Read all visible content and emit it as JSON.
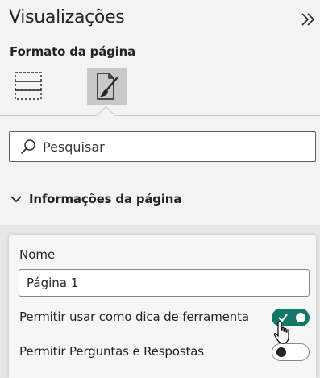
{
  "pane": {
    "title": "Visualizações",
    "subtitle": "Formato da página"
  },
  "tabs": [
    {
      "icon": "visual-build-icon",
      "selected": false
    },
    {
      "icon": "format-page-icon",
      "selected": true
    }
  ],
  "search": {
    "placeholder": "Pesquisar",
    "value": ""
  },
  "section": {
    "label": "Informações da página",
    "expanded": true
  },
  "page_info": {
    "name_label": "Nome",
    "name_value": "Página 1",
    "tooltip_label": "Permitir usar como dica de ferramenta",
    "tooltip_on": true,
    "qa_label": "Permitir Perguntas e Respostas",
    "qa_on": false
  },
  "colors": {
    "accent": "#117865",
    "selected_tab": "#c8c8c8"
  }
}
